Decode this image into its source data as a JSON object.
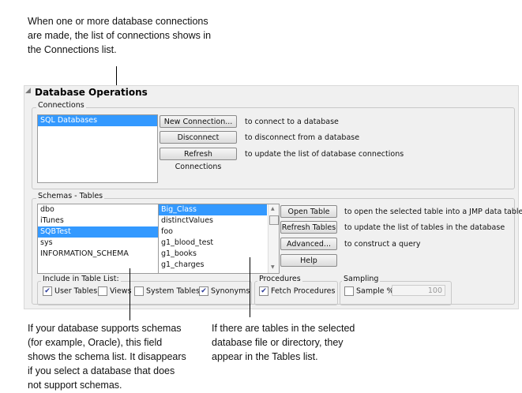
{
  "annotations": {
    "top": "When one or more database connections\nare made, the list of connections shows in\nthe Connections list.",
    "bottom_left": "If your database supports schemas\n(for example, Oracle), this field\nshows the schema list. It disappears\nif you select a database that does\nnot support schemas.",
    "bottom_right": "If there are tables in the selected\ndatabase file or directory, they\nappear in the Tables list."
  },
  "panel": {
    "title": "Database Operations"
  },
  "connections": {
    "label": "Connections",
    "items": [
      "SQL Databases"
    ],
    "buttons": [
      {
        "label": "New Connection...",
        "desc": "to connect to a database"
      },
      {
        "label": "Disconnect",
        "desc": "to disconnect from a database"
      },
      {
        "label": "Refresh Connections",
        "desc": "to update the list of database connections"
      }
    ]
  },
  "schemas": {
    "label": "Schemas - Tables",
    "schema_items": [
      "dbo",
      "iTunes",
      "SQBTest",
      "sys",
      "INFORMATION_SCHEMA"
    ],
    "table_items": [
      "Big_Class",
      "distinctValues",
      "foo",
      "g1_blood_test",
      "g1_books",
      "g1_charges"
    ],
    "buttons": [
      {
        "label": "Open Table",
        "desc": "to open the selected table into a JMP data table"
      },
      {
        "label": "Refresh Tables",
        "desc": "to update the list of tables in the database"
      },
      {
        "label": "Advanced...",
        "desc": "to construct a query"
      },
      {
        "label": "Help",
        "desc": ""
      }
    ]
  },
  "include": {
    "label": "Include in Table List:",
    "options": [
      {
        "label": "User Tables",
        "checked": true
      },
      {
        "label": "Views",
        "checked": false
      },
      {
        "label": "System Tables",
        "checked": false
      },
      {
        "label": "Synonyms",
        "checked": true
      }
    ]
  },
  "procedures": {
    "label": "Procedures",
    "option": "Fetch Procedures",
    "checked": true
  },
  "sampling": {
    "label": "Sampling",
    "option": "Sample %",
    "checked": false,
    "value": "100"
  }
}
